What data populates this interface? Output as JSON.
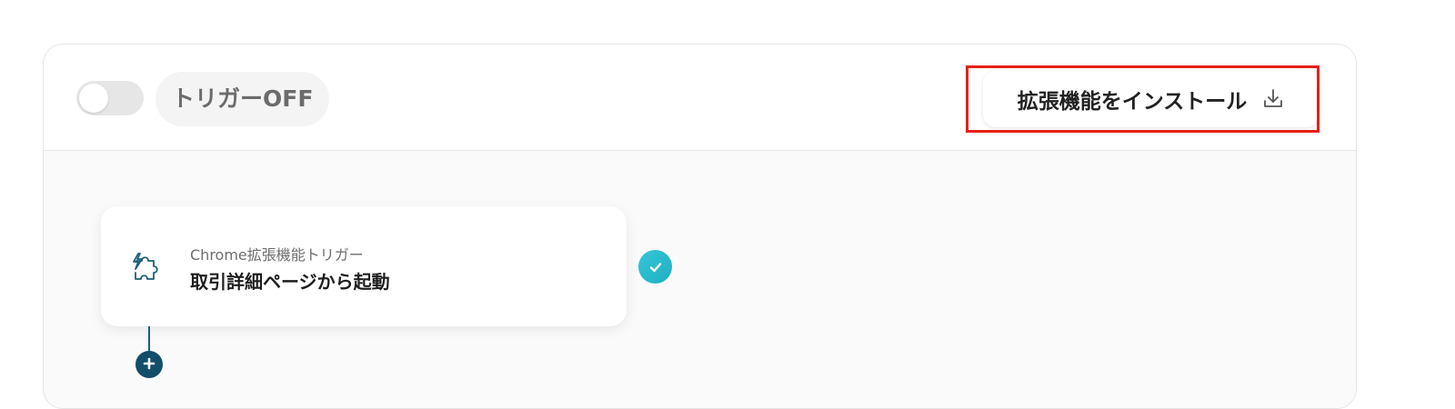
{
  "topbar": {
    "trigger_status_label": "トリガーOFF",
    "trigger_enabled": false,
    "install_button_label": "拡張機能をインストール",
    "install_icon": "download-icon"
  },
  "flow": {
    "nodes": [
      {
        "icon": "puzzle-lightning-icon",
        "subtitle": "Chrome拡張機能トリガー",
        "title": "取引詳細ページから起動",
        "status": "check-icon"
      }
    ],
    "add_step_icon": "plus-icon"
  },
  "colors": {
    "highlight": "#e52119",
    "check_badge": "#2bbccf",
    "connector": "#134d6a",
    "toggle_off": "#e6e6e6"
  }
}
